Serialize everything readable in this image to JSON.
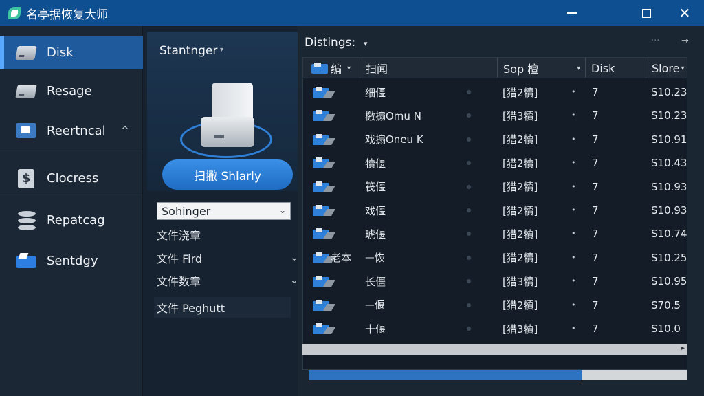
{
  "window": {
    "title": "名亭据恢复大师",
    "close_glyph": "✕"
  },
  "sidebar": {
    "items": [
      {
        "label": "Disk",
        "icon": "disk-icon",
        "active": true
      },
      {
        "label": "Resage",
        "icon": "drive-icon"
      },
      {
        "label": "Reertncal",
        "icon": "monitor-icon",
        "chevron": "^"
      },
      {
        "label": "Clocress",
        "icon": "dollar-icon",
        "glyph": "$"
      },
      {
        "label": "Repatcag",
        "icon": "database-icon"
      },
      {
        "label": "Sentdgy",
        "icon": "folder-icon"
      }
    ]
  },
  "middle": {
    "title": "Stantnger",
    "title_chevron": "▾",
    "scan_button": "扫撇 Shlarly",
    "select_value": "Sohinger",
    "select_chevron": "⌄",
    "options": [
      {
        "label": "文件浇章",
        "chevron": ""
      },
      {
        "label": "文件 Fird",
        "chevron": "⌄"
      },
      {
        "label": "文件数章",
        "chevron": "⌄"
      },
      {
        "label": "文件 Peghutt",
        "chevron": ""
      }
    ]
  },
  "right": {
    "heading": "Distings:",
    "heading_chevron": "▾",
    "dots": "···",
    "arrow": "→",
    "columns": [
      {
        "label": "编",
        "sort": "▾"
      },
      {
        "label": "扫闻",
        "sort": ""
      },
      {
        "label": "Sop 檀",
        "sort": "▾"
      },
      {
        "label": "Disk",
        "sort": ""
      },
      {
        "label": "Slore",
        "sort": "▾"
      }
    ],
    "rows": [
      {
        "name": "",
        "file": "细偃",
        "type": "[猎2犢]",
        "mark": "•",
        "disk": "7",
        "size": "S10.23"
      },
      {
        "name": "",
        "file": "檄搧Omu N",
        "type": "[猎3犢]",
        "mark": "•",
        "disk": "7",
        "size": "S10.23"
      },
      {
        "name": "",
        "file": "戏搧Oneu K",
        "type": "[猎2犢]",
        "mark": "•",
        "disk": "7",
        "size": "S10.91"
      },
      {
        "name": "",
        "file": "犢偃",
        "type": "[猎2犢]",
        "mark": "•",
        "disk": "7",
        "size": "S10.43"
      },
      {
        "name": "",
        "file": "筏偃",
        "type": "[猎2犢]",
        "mark": "•",
        "disk": "7",
        "size": "S10.93"
      },
      {
        "name": "",
        "file": "戏偃",
        "type": "[猎2犢]",
        "mark": "•",
        "disk": "7",
        "size": "S10.93"
      },
      {
        "name": "",
        "file": "琥偃",
        "type": "[猎2犢]",
        "mark": "•",
        "disk": "7",
        "size": "S10.74"
      },
      {
        "name": "老本",
        "file": "ᅳ恢",
        "type": "[猎2犢]",
        "mark": "•",
        "disk": "7",
        "size": "S10.25"
      },
      {
        "name": "",
        "file": "长僵",
        "type": "[猎3犢]",
        "mark": "•",
        "disk": "7",
        "size": "S10.95"
      },
      {
        "name": "",
        "file": "ᅳ偃",
        "type": "[猎2犢]",
        "mark": "•",
        "disk": "7",
        "size": "S70.5"
      },
      {
        "name": "",
        "file": "十偃",
        "type": "[猎3犢]",
        "mark": "•",
        "disk": "7",
        "size": "S10.0"
      }
    ],
    "scroll_arrow": "▸",
    "progress": 0.72
  }
}
